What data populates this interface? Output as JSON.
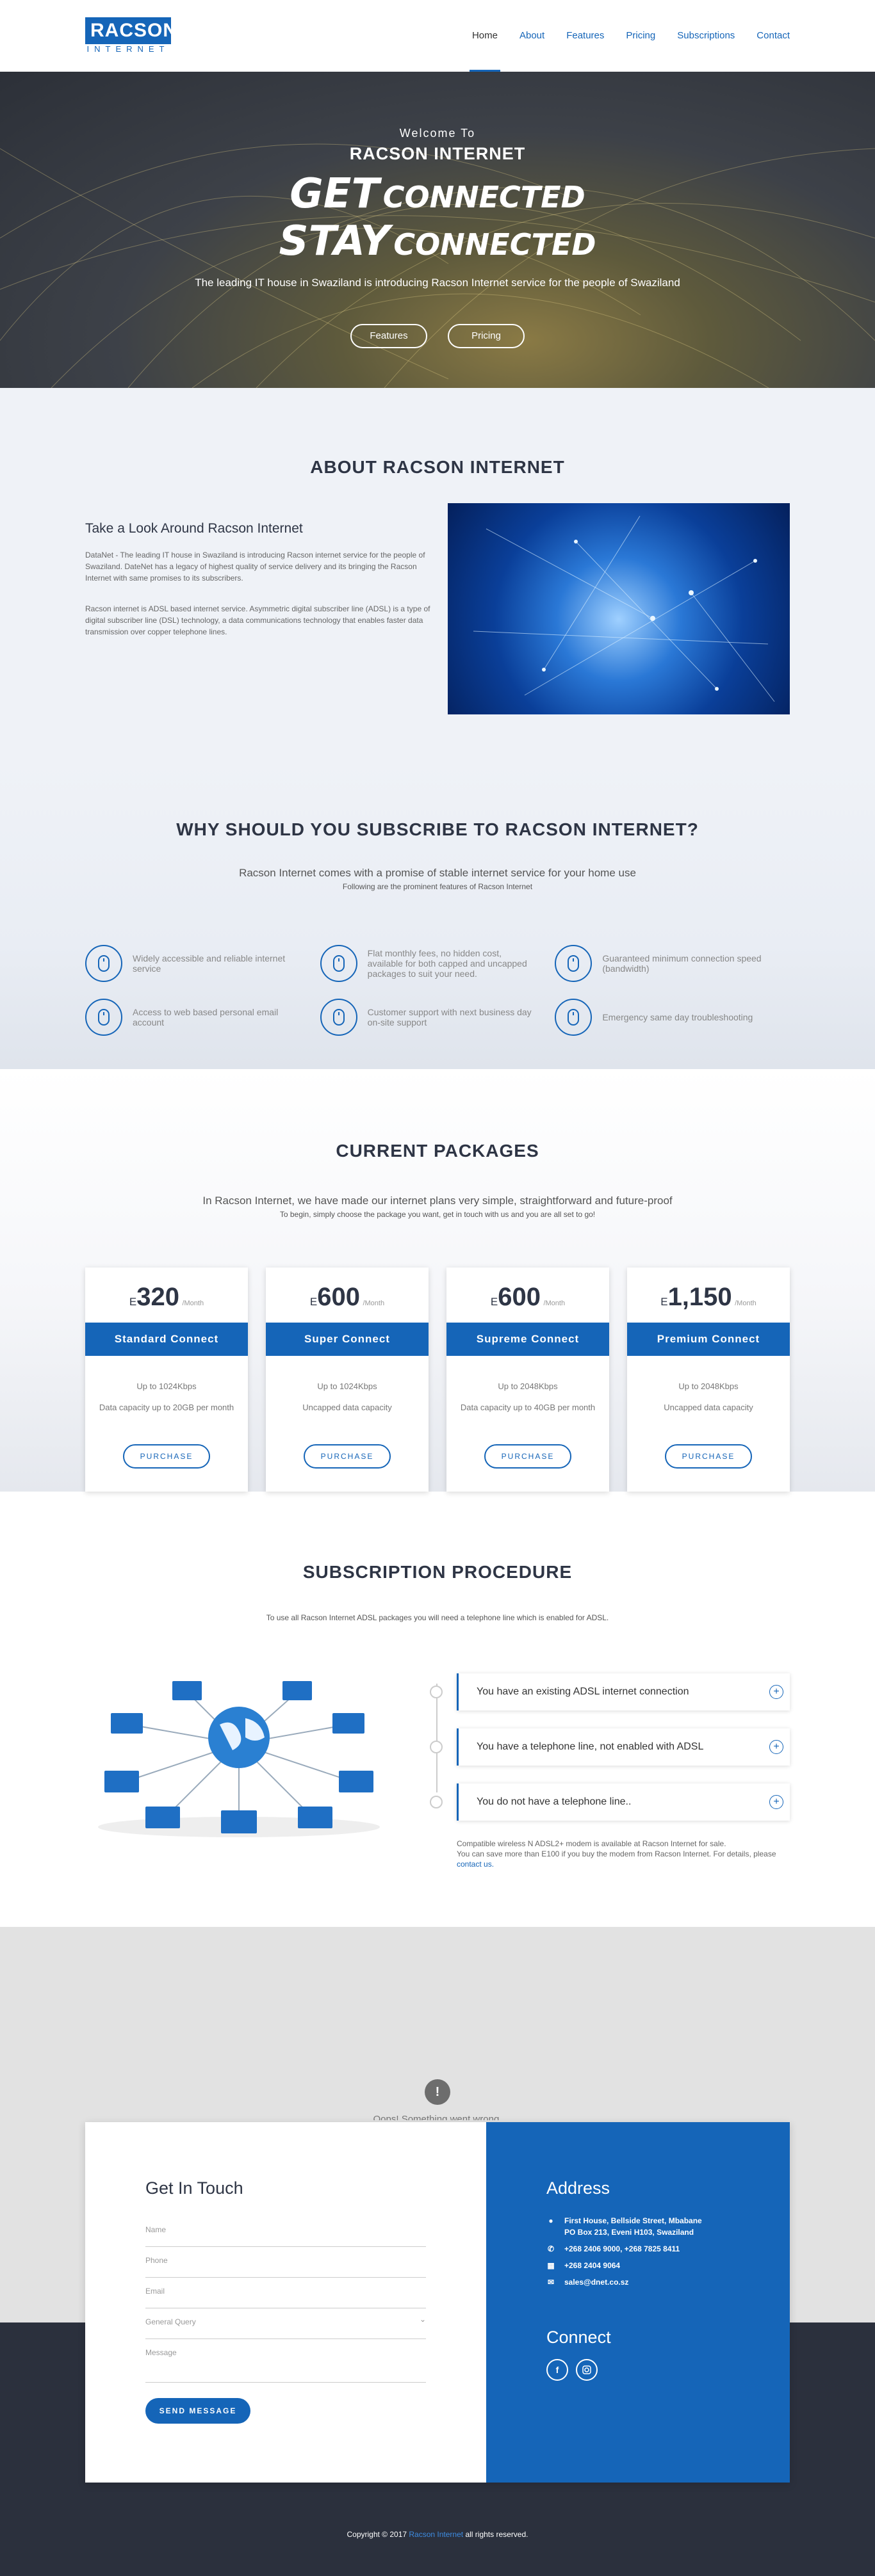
{
  "header": {
    "logo_top": "RACSON",
    "logo_bottom": "INTERNET",
    "nav": [
      {
        "label": "Home",
        "active": true
      },
      {
        "label": "About"
      },
      {
        "label": "Features"
      },
      {
        "label": "Pricing"
      },
      {
        "label": "Subscriptions"
      },
      {
        "label": "Contact"
      }
    ]
  },
  "hero": {
    "welcome": "Welcome To",
    "brand": "RACSON INTERNET",
    "line1_big": "GET",
    "line1_small": "CONNECTED",
    "line2_big": "STAY",
    "line2_small": "CONNECTED",
    "lead": "The leading IT house in Swaziland is introducing Racson Internet service for the people of Swaziland",
    "btn_features": "Features",
    "btn_pricing": "Pricing"
  },
  "about": {
    "title": "ABOUT RACSON INTERNET",
    "heading": "Take a Look Around Racson Internet",
    "p1": "DataNet - The leading IT house in Swaziland is introducing Racson internet service for the people of Swaziland. DateNet has a legacy of highest quality of service delivery and its bringing the Racson Internet with same promises to its subscribers.",
    "p2": "Racson internet is ADSL based internet service. Asymmetric digital subscriber line (ADSL) is a type of digital subscriber line (DSL) technology, a data communications technology that enables faster data transmission over copper telephone lines."
  },
  "why": {
    "title": "WHY SHOULD YOU SUBSCRIBE TO RACSON INTERNET?",
    "sub": "Racson Internet comes with a promise of stable internet service for your home use",
    "sub2": "Following are the prominent features of Racson Internet",
    "features": [
      "Widely accessible and reliable internet service",
      "Flat monthly fees, no hidden cost, available for both capped and uncapped packages to suit your need.",
      "Guaranteed minimum connection speed (bandwidth)",
      "Access to web based personal email account",
      "Customer support with next business day on-site support",
      "Emergency same day troubleshooting"
    ]
  },
  "packages": {
    "title": "CURRENT PACKAGES",
    "sub": "In Racson Internet, we have made our internet plans very simple, straightforward and future-proof",
    "sub2": "To begin, simply choose the package you want, get in touch with us and you are all set to go!",
    "currency": "E",
    "per": "/Month",
    "buy_label": "PURCHASE",
    "items": [
      {
        "price": "320",
        "name": "Standard Connect",
        "speed": "Up to 1024Kbps",
        "cap": "Data capacity up to 20GB per month"
      },
      {
        "price": "600",
        "name": "Super Connect",
        "speed": "Up to 1024Kbps",
        "cap": "Uncapped data capacity"
      },
      {
        "price": "600",
        "name": "Supreme Connect",
        "speed": "Up to 2048Kbps",
        "cap": "Data capacity up to 40GB per month"
      },
      {
        "price": "1,150",
        "name": "Premium Connect",
        "speed": "Up to 2048Kbps",
        "cap": "Uncapped data capacity"
      }
    ]
  },
  "subscription": {
    "title": "SUBSCRIPTION PROCEDURE",
    "sub": "To use all Racson Internet ADSL packages you will need a telephone line which is enabled for ADSL.",
    "options": [
      "You have an existing ADSL internet connection",
      "You have a telephone line, not enabled with ADSL",
      "You do not have a telephone line.."
    ],
    "note1": "Compatible wireless N ADSL2+ modem is available at Racson Internet for sale.",
    "note2": "You can save more than E100 if you buy the modem from Racson Internet. For details, please",
    "note_link": "contact us."
  },
  "contact": {
    "alert_icon": "!",
    "alert_text": "Oops! Something went wrong.",
    "title": "Get In Touch",
    "field_name": "Name",
    "field_phone": "Phone",
    "field_email": "Email",
    "field_query": "General Query",
    "field_message": "Message",
    "send": "SEND MESSAGE",
    "address_title": "Address",
    "address_line1": "First House, Bellside Street, Mbabane",
    "address_line2": "PO Box 213, Eveni H103, Swaziland",
    "phone": "+268 2406 9000, +268 7825 8411",
    "fax": "+268 2404 9064",
    "email": "sales@dnet.co.sz",
    "connect_title": "Connect",
    "social_fb": "f",
    "copyright_pre": "Copyright © 2017",
    "copyright_link": "Racson Internet",
    "copyright_post": "all rights reserved."
  },
  "colors": {
    "brand": "#1565b8",
    "dark": "#2b303d"
  }
}
